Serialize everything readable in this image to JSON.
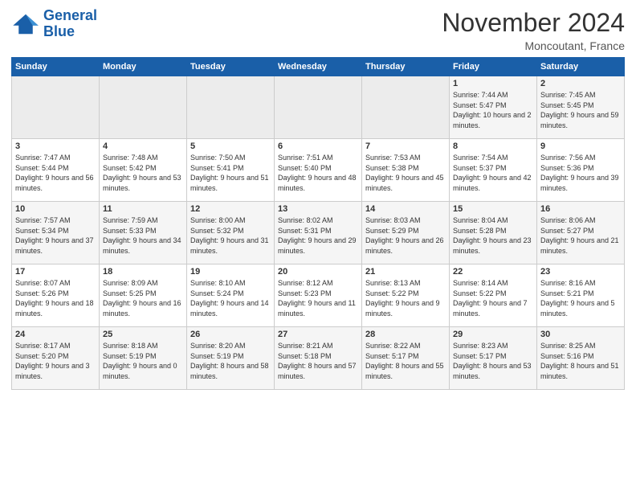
{
  "header": {
    "logo_line1": "General",
    "logo_line2": "Blue",
    "title": "November 2024",
    "subtitle": "Moncoutant, France"
  },
  "weekdays": [
    "Sunday",
    "Monday",
    "Tuesday",
    "Wednesday",
    "Thursday",
    "Friday",
    "Saturday"
  ],
  "weeks": [
    [
      {
        "day": "",
        "empty": true
      },
      {
        "day": "",
        "empty": true
      },
      {
        "day": "",
        "empty": true
      },
      {
        "day": "",
        "empty": true
      },
      {
        "day": "",
        "empty": true
      },
      {
        "day": "1",
        "sunrise": "7:44 AM",
        "sunset": "5:47 PM",
        "daylight": "10 hours and 2 minutes."
      },
      {
        "day": "2",
        "sunrise": "7:45 AM",
        "sunset": "5:45 PM",
        "daylight": "9 hours and 59 minutes."
      }
    ],
    [
      {
        "day": "3",
        "sunrise": "7:47 AM",
        "sunset": "5:44 PM",
        "daylight": "9 hours and 56 minutes."
      },
      {
        "day": "4",
        "sunrise": "7:48 AM",
        "sunset": "5:42 PM",
        "daylight": "9 hours and 53 minutes."
      },
      {
        "day": "5",
        "sunrise": "7:50 AM",
        "sunset": "5:41 PM",
        "daylight": "9 hours and 51 minutes."
      },
      {
        "day": "6",
        "sunrise": "7:51 AM",
        "sunset": "5:40 PM",
        "daylight": "9 hours and 48 minutes."
      },
      {
        "day": "7",
        "sunrise": "7:53 AM",
        "sunset": "5:38 PM",
        "daylight": "9 hours and 45 minutes."
      },
      {
        "day": "8",
        "sunrise": "7:54 AM",
        "sunset": "5:37 PM",
        "daylight": "9 hours and 42 minutes."
      },
      {
        "day": "9",
        "sunrise": "7:56 AM",
        "sunset": "5:36 PM",
        "daylight": "9 hours and 39 minutes."
      }
    ],
    [
      {
        "day": "10",
        "sunrise": "7:57 AM",
        "sunset": "5:34 PM",
        "daylight": "9 hours and 37 minutes."
      },
      {
        "day": "11",
        "sunrise": "7:59 AM",
        "sunset": "5:33 PM",
        "daylight": "9 hours and 34 minutes."
      },
      {
        "day": "12",
        "sunrise": "8:00 AM",
        "sunset": "5:32 PM",
        "daylight": "9 hours and 31 minutes."
      },
      {
        "day": "13",
        "sunrise": "8:02 AM",
        "sunset": "5:31 PM",
        "daylight": "9 hours and 29 minutes."
      },
      {
        "day": "14",
        "sunrise": "8:03 AM",
        "sunset": "5:29 PM",
        "daylight": "9 hours and 26 minutes."
      },
      {
        "day": "15",
        "sunrise": "8:04 AM",
        "sunset": "5:28 PM",
        "daylight": "9 hours and 23 minutes."
      },
      {
        "day": "16",
        "sunrise": "8:06 AM",
        "sunset": "5:27 PM",
        "daylight": "9 hours and 21 minutes."
      }
    ],
    [
      {
        "day": "17",
        "sunrise": "8:07 AM",
        "sunset": "5:26 PM",
        "daylight": "9 hours and 18 minutes."
      },
      {
        "day": "18",
        "sunrise": "8:09 AM",
        "sunset": "5:25 PM",
        "daylight": "9 hours and 16 minutes."
      },
      {
        "day": "19",
        "sunrise": "8:10 AM",
        "sunset": "5:24 PM",
        "daylight": "9 hours and 14 minutes."
      },
      {
        "day": "20",
        "sunrise": "8:12 AM",
        "sunset": "5:23 PM",
        "daylight": "9 hours and 11 minutes."
      },
      {
        "day": "21",
        "sunrise": "8:13 AM",
        "sunset": "5:22 PM",
        "daylight": "9 hours and 9 minutes."
      },
      {
        "day": "22",
        "sunrise": "8:14 AM",
        "sunset": "5:22 PM",
        "daylight": "9 hours and 7 minutes."
      },
      {
        "day": "23",
        "sunrise": "8:16 AM",
        "sunset": "5:21 PM",
        "daylight": "9 hours and 5 minutes."
      }
    ],
    [
      {
        "day": "24",
        "sunrise": "8:17 AM",
        "sunset": "5:20 PM",
        "daylight": "9 hours and 3 minutes."
      },
      {
        "day": "25",
        "sunrise": "8:18 AM",
        "sunset": "5:19 PM",
        "daylight": "9 hours and 0 minutes."
      },
      {
        "day": "26",
        "sunrise": "8:20 AM",
        "sunset": "5:19 PM",
        "daylight": "8 hours and 58 minutes."
      },
      {
        "day": "27",
        "sunrise": "8:21 AM",
        "sunset": "5:18 PM",
        "daylight": "8 hours and 57 minutes."
      },
      {
        "day": "28",
        "sunrise": "8:22 AM",
        "sunset": "5:17 PM",
        "daylight": "8 hours and 55 minutes."
      },
      {
        "day": "29",
        "sunrise": "8:23 AM",
        "sunset": "5:17 PM",
        "daylight": "8 hours and 53 minutes."
      },
      {
        "day": "30",
        "sunrise": "8:25 AM",
        "sunset": "5:16 PM",
        "daylight": "8 hours and 51 minutes."
      }
    ]
  ]
}
